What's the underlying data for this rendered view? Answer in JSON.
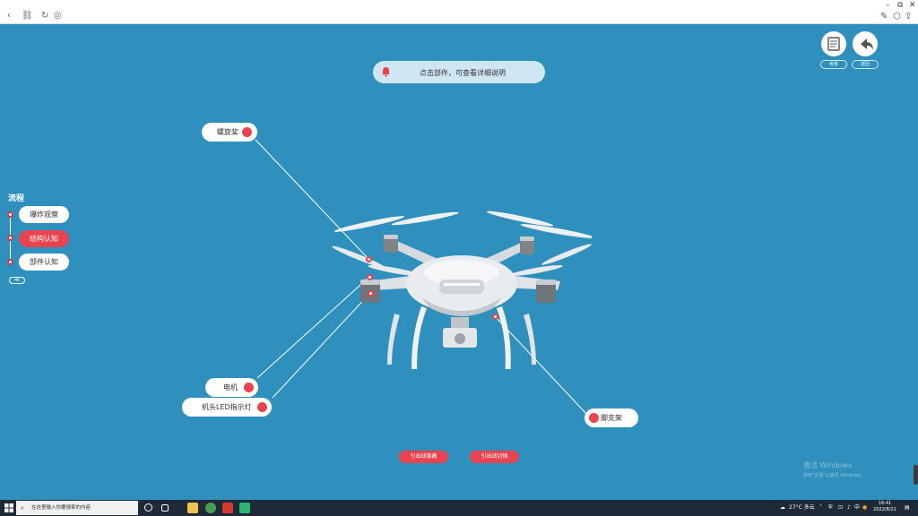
{
  "hint": {
    "text": "点击部件，可查看详细说明",
    "icon": "bell-icon"
  },
  "top_right": [
    {
      "icon": "book-icon",
      "label": "考核"
    },
    {
      "icon": "return-arrow-icon",
      "label": "返回"
    }
  ],
  "flow": {
    "title": "流程",
    "steps": [
      {
        "label": "爆炸观察",
        "active": false
      },
      {
        "label": "结构认知",
        "active": true
      },
      {
        "label": "部件认知",
        "active": false
      }
    ],
    "collapse_label": "≪"
  },
  "parts": [
    {
      "name": "螺旋桨"
    },
    {
      "name": "电机"
    },
    {
      "name": "机头LED指示灯"
    },
    {
      "name": "脚支架"
    }
  ],
  "buttons": {
    "hide_lines": "引出线隐藏",
    "switch_lines": "引出线切换"
  },
  "watermark": {
    "line1": "激活 Windows",
    "line2": "转到\"设置\"以激活 Windows。"
  },
  "taskbar": {
    "search_placeholder": "在这里输入你要搜索的内容",
    "weather": "27°C 多云",
    "time": "16:41",
    "date": "2022/8/21"
  },
  "colors": {
    "background": "#2f8fbd",
    "accent_red": "#e8434f",
    "hint_bg": "#cfe7f2"
  }
}
